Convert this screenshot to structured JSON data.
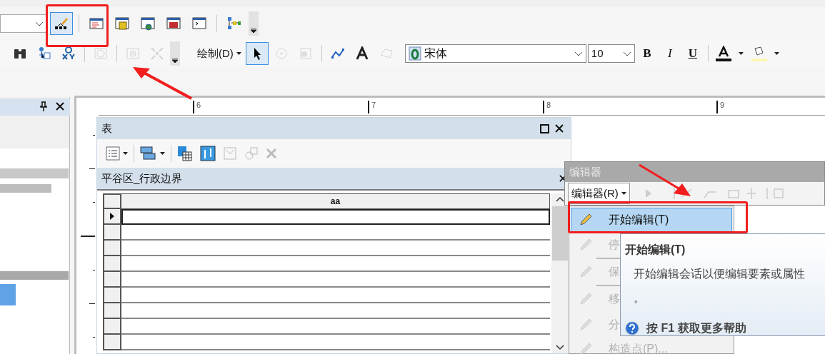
{
  "toolbar_1": [
    {
      "kind": "combo"
    },
    {
      "kind": "edit-tool",
      "selected": true,
      "disabled": false
    },
    {
      "kind": "separator"
    },
    {
      "kind": "table-window",
      "selected": false,
      "disabled": false
    },
    {
      "kind": "catalog",
      "selected": false,
      "disabled": false
    },
    {
      "kind": "search-window",
      "selected": false,
      "disabled": false
    },
    {
      "kind": "toolbox",
      "selected": false,
      "disabled": false
    },
    {
      "kind": "python",
      "selected": false,
      "disabled": false
    },
    {
      "kind": "separator"
    },
    {
      "kind": "model",
      "selected": false,
      "disabled": false
    },
    {
      "kind": "overflow"
    }
  ],
  "toolbar_2": [
    {
      "kind": "binoculars",
      "selected": false,
      "disabled": false
    },
    {
      "kind": "layer-tree",
      "selected": false,
      "disabled": false
    },
    {
      "kind": "xy",
      "selected": false,
      "disabled": false
    },
    {
      "kind": "separator"
    },
    {
      "kind": "clock",
      "selected": false,
      "disabled": true
    },
    {
      "kind": "separator"
    },
    {
      "kind": "zoom-frame",
      "selected": false,
      "disabled": true
    },
    {
      "kind": "full-extent",
      "selected": false,
      "disabled": true
    },
    {
      "kind": "overflow"
    }
  ],
  "draw_toolbar": {
    "menu_label": "绘制(D)",
    "tools": [
      {
        "kind": "select-arrow",
        "selected": true,
        "disabled": false
      },
      {
        "kind": "rotate",
        "selected": false,
        "disabled": true
      },
      {
        "kind": "graphic",
        "selected": false,
        "disabled": true
      },
      {
        "kind": "separator"
      },
      {
        "kind": "polyline",
        "selected": false,
        "disabled": false
      },
      {
        "kind": "text",
        "selected": false,
        "disabled": false
      },
      {
        "kind": "polygon",
        "selected": false,
        "disabled": true
      }
    ],
    "font": "宋体",
    "size": "10",
    "styles": [
      "B",
      "I",
      "U"
    ]
  },
  "ruler": {
    "labels": [
      "6",
      "7",
      "8",
      "9"
    ]
  },
  "table_window": {
    "title": "表",
    "layer_tab": "平谷区_行政边界",
    "columns": [
      "aa"
    ],
    "rows": [
      {
        "current": true
      },
      {
        "current": false
      },
      {
        "current": false
      },
      {
        "current": false
      },
      {
        "current": false
      },
      {
        "current": false
      },
      {
        "current": false
      },
      {
        "current": false
      },
      {
        "current": false
      }
    ]
  },
  "editor_toolbar": {
    "title": "编辑器",
    "menu_label": "编辑器(R)"
  },
  "editor_menu": [
    {
      "label": "开始编辑(T)",
      "selected": true,
      "disabled": false,
      "divider_before": false
    },
    {
      "label": "停",
      "selected": false,
      "disabled": true,
      "divider_before": false
    },
    {
      "label": "保",
      "selected": false,
      "disabled": true,
      "divider_before": true
    },
    {
      "label": "移",
      "selected": false,
      "disabled": true,
      "divider_before": true
    },
    {
      "label": "分",
      "selected": false,
      "disabled": true,
      "divider_before": false
    },
    {
      "label": "构造点(P)...",
      "selected": false,
      "disabled": true,
      "divider_before": false
    }
  ],
  "tooltip": {
    "title": "开始编辑(T)",
    "description": [
      "开始编辑会话以便编辑要素或属性",
      "。"
    ],
    "help": "按 F1 获取更多帮助"
  }
}
